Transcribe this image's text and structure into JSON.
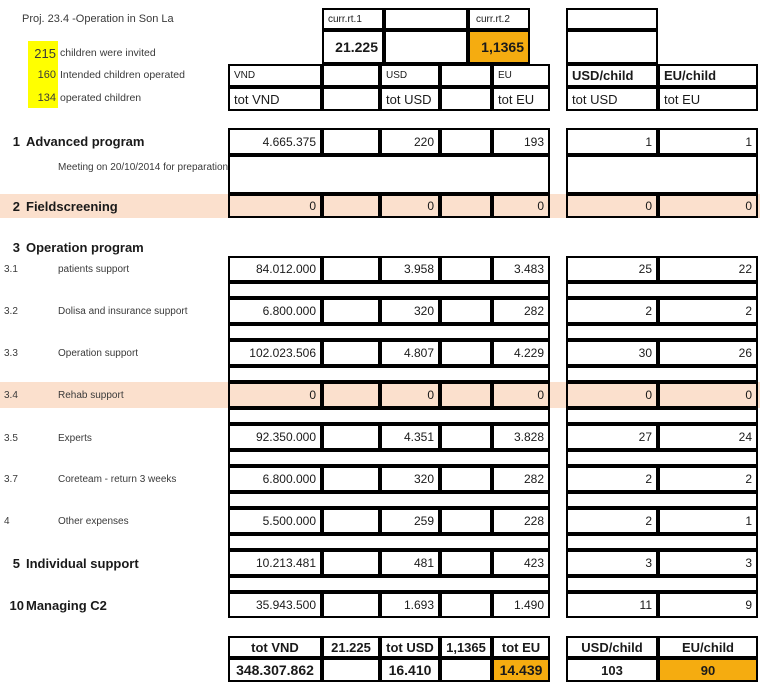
{
  "document": {
    "title": "Proj. 23.4 -Operation in Son La"
  },
  "stats": [
    {
      "value": "215",
      "label": "children were invited"
    },
    {
      "value": "160",
      "label": "Intended children operated"
    },
    {
      "value": "134",
      "label": "operated children"
    }
  ],
  "colors": {
    "highlight_yellow": "#ffff00",
    "highlight_orange": "#f5ac10",
    "band_peach": "#fbe0cd",
    "border": "#000000"
  },
  "rates": {
    "rate1_label": "curr.rt.1",
    "rate1_value": "21.225",
    "rate2_label": "curr.rt.2",
    "rate2_value": "1,1365"
  },
  "column_headers": {
    "vnd": "VND",
    "usd": "USD",
    "eu": "EU",
    "tot_vnd": "tot VND",
    "tot_usd": "tot USD",
    "tot_eu": "tot EU",
    "usd_child": "USD/child",
    "eu_child": "EU/child",
    "per_child_tot_usd": "tot USD",
    "per_child_tot_eu": "tot EU"
  },
  "rows": [
    {
      "code": "1",
      "name": "Advanced program",
      "style": "major",
      "vnd": "4.665.375",
      "usd": "220",
      "eu": "193",
      "usd_child": "1",
      "eu_child": "1"
    },
    {
      "code": "",
      "name": "Meeting on 20/10/2014 for preparation",
      "style": "note",
      "vnd": "",
      "usd": "",
      "eu": "",
      "usd_child": "",
      "eu_child": ""
    },
    {
      "code": "2",
      "name": "Fieldscreening",
      "style": "major-peach",
      "vnd": "0",
      "usd": "0",
      "eu": "0",
      "usd_child": "0",
      "eu_child": "0"
    },
    {
      "code": "3",
      "name": "Operation program",
      "style": "major-nocells",
      "vnd": "",
      "usd": "",
      "eu": "",
      "usd_child": "",
      "eu_child": ""
    },
    {
      "code": "3.1",
      "name": "patients support",
      "style": "sub",
      "vnd": "84.012.000",
      "usd": "3.958",
      "eu": "3.483",
      "usd_child": "25",
      "eu_child": "22"
    },
    {
      "code": "3.2",
      "name": "Dolisa and insurance support",
      "style": "sub",
      "vnd": "6.800.000",
      "usd": "320",
      "eu": "282",
      "usd_child": "2",
      "eu_child": "2"
    },
    {
      "code": "3.3",
      "name": "Operation support",
      "style": "sub",
      "vnd": "102.023.506",
      "usd": "4.807",
      "eu": "4.229",
      "usd_child": "30",
      "eu_child": "26"
    },
    {
      "code": "3.4",
      "name": "Rehab support",
      "style": "sub-peach",
      "vnd": "0",
      "usd": "0",
      "eu": "0",
      "usd_child": "0",
      "eu_child": "0"
    },
    {
      "code": "3.5",
      "name": "Experts",
      "style": "sub",
      "vnd": "92.350.000",
      "usd": "4.351",
      "eu": "3.828",
      "usd_child": "27",
      "eu_child": "24"
    },
    {
      "code": "3.7",
      "name": "Coreteam - return 3 weeks",
      "style": "sub",
      "vnd": "6.800.000",
      "usd": "320",
      "eu": "282",
      "usd_child": "2",
      "eu_child": "2"
    },
    {
      "code": "4",
      "name": "Other expenses",
      "style": "sub",
      "vnd": "5.500.000",
      "usd": "259",
      "eu": "228",
      "usd_child": "2",
      "eu_child": "1"
    },
    {
      "code": "5",
      "name": "Individual support",
      "style": "major",
      "vnd": "10.213.481",
      "usd": "481",
      "eu": "423",
      "usd_child": "3",
      "eu_child": "3"
    },
    {
      "code": "10",
      "name": "Managing C2",
      "style": "major",
      "vnd": "35.943.500",
      "usd": "1.693",
      "eu": "1.490",
      "usd_child": "11",
      "eu_child": "9"
    }
  ],
  "totals": {
    "tot_vnd_label": "tot VND",
    "rate1": "21.225",
    "tot_usd_label": "tot USD",
    "rate2": "1,1365",
    "tot_eu_label": "tot EU",
    "tot_vnd_value": "348.307.862",
    "tot_usd_value": "16.410",
    "tot_eu_value": "14.439",
    "usd_child_label": "USD/child",
    "eu_child_label": "EU/child",
    "usd_child_value": "103",
    "eu_child_value": "90"
  }
}
